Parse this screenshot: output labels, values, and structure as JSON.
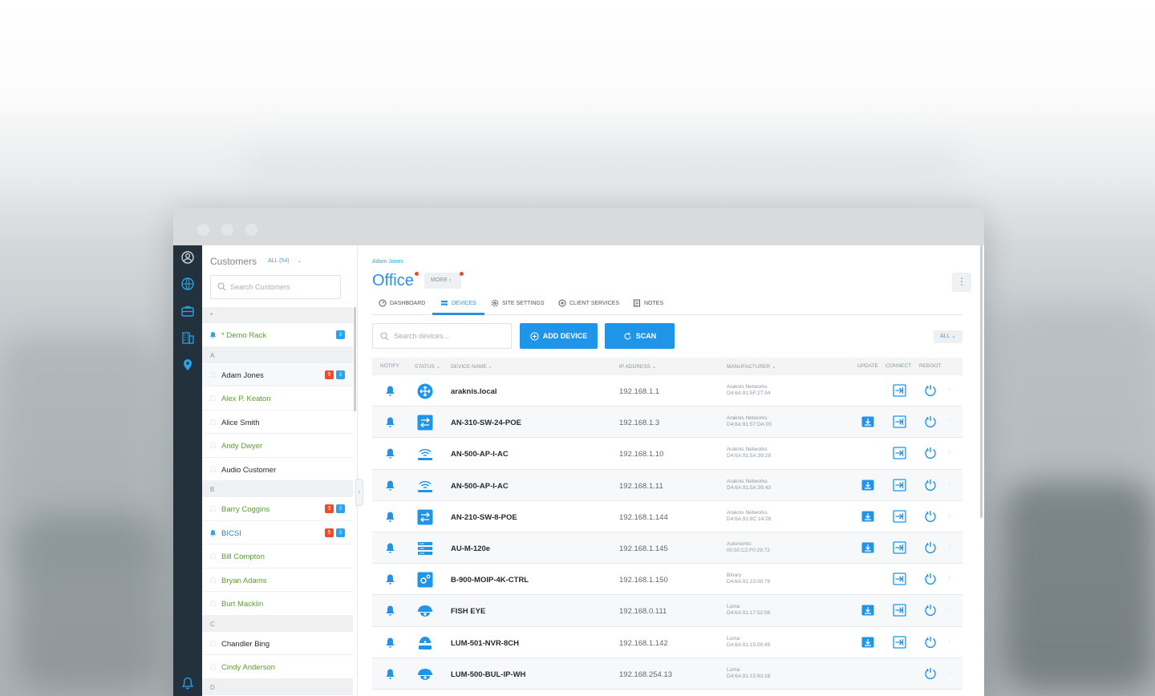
{
  "sidebar_rail": {
    "icons": [
      "user-circle-icon",
      "globe-icon",
      "briefcase-icon",
      "building-icon",
      "location-pin-icon"
    ],
    "bottom_icon": "bell-icon"
  },
  "customers": {
    "title": "Customers",
    "filter": "ALL (54)",
    "search_placeholder": "Search Customers",
    "sections": [
      {
        "letter": "*",
        "items": [
          {
            "name": "* Demo Rack",
            "style": "green",
            "notify": true,
            "badge_red": "",
            "badge_blue": true
          }
        ]
      },
      {
        "letter": "A",
        "items": [
          {
            "name": "Adam Jones",
            "style": "dark",
            "notify": false,
            "badge_red": "9",
            "badge_blue": true,
            "selected": true
          },
          {
            "name": "Alex P. Keaton",
            "style": "green",
            "notify": false,
            "badge_red": "",
            "badge_blue": false
          },
          {
            "name": "Alice Smith",
            "style": "dark",
            "notify": false,
            "badge_red": "",
            "badge_blue": false
          },
          {
            "name": "Andy Dwyer",
            "style": "green",
            "notify": false,
            "badge_red": "",
            "badge_blue": false
          },
          {
            "name": "Audio Customer",
            "style": "dark",
            "notify": false,
            "badge_red": "",
            "badge_blue": false
          }
        ]
      },
      {
        "letter": "B",
        "items": [
          {
            "name": "Barry Coggins",
            "style": "green",
            "notify": false,
            "badge_red": "3",
            "badge_blue": true
          },
          {
            "name": "BICSI",
            "style": "blue",
            "notify": true,
            "badge_red": "5",
            "badge_blue": true
          },
          {
            "name": "Bill Compton",
            "style": "green",
            "notify": false,
            "badge_red": "",
            "badge_blue": false
          },
          {
            "name": "Bryan Adams",
            "style": "green",
            "notify": false,
            "badge_red": "",
            "badge_blue": false
          },
          {
            "name": "Burt Macklin",
            "style": "green",
            "notify": false,
            "badge_red": "",
            "badge_blue": false
          }
        ]
      },
      {
        "letter": "C",
        "items": [
          {
            "name": "Chandler Bing",
            "style": "dark",
            "notify": false,
            "badge_red": "",
            "badge_blue": false
          },
          {
            "name": "Cindy Anderson",
            "style": "green",
            "notify": false,
            "badge_red": "",
            "badge_blue": false
          }
        ]
      },
      {
        "letter": "D",
        "items": []
      }
    ]
  },
  "site": {
    "breadcrumb": "Adam Jones",
    "title": "Office",
    "more_label": "MORE",
    "tabs": [
      {
        "label": "DASHBOARD",
        "icon": "dashboard-icon",
        "active": false
      },
      {
        "label": "DEVICES",
        "icon": "devices-icon",
        "active": true
      },
      {
        "label": "SITE SETTINGS",
        "icon": "settings-icon",
        "active": false
      },
      {
        "label": "CLIENT SERVICES",
        "icon": "services-icon",
        "active": false
      },
      {
        "label": "NOTES",
        "icon": "notes-icon",
        "active": false
      }
    ]
  },
  "toolbar": {
    "search_placeholder": "Search devices...",
    "add_device_label": "ADD DEVICE",
    "scan_label": "SCAN",
    "filter_label": "ALL"
  },
  "table": {
    "headers": {
      "notify": "NOTIFY",
      "status": "STATUS",
      "device_name": "DEVICE NAME",
      "ip_address": "IP ADDRESS",
      "manufacturer": "MANUFACTURER",
      "update": "UPDATE",
      "connect": "CONNECT",
      "reboot": "REBOOT"
    },
    "rows": [
      {
        "name": "araknis.local",
        "icon": "router",
        "ip": "192.168.1.1",
        "mfr": "Araknis Networks",
        "mac": "D4:6A:91:5F:27:54",
        "update": false,
        "connect": true
      },
      {
        "name": "AN-310-SW-24-POE",
        "icon": "switch",
        "ip": "192.168.1.3",
        "mfr": "Araknis Networks",
        "mac": "D4:6A:91:57:DA:00",
        "update": true,
        "connect": true
      },
      {
        "name": "AN-500-AP-I-AC",
        "icon": "wifi",
        "ip": "192.168.1.10",
        "mfr": "Araknis Networks",
        "mac": "D4:6A:91:5A:39:28",
        "update": false,
        "connect": true
      },
      {
        "name": "AN-500-AP-I-AC",
        "icon": "wifi",
        "ip": "192.168.1.11",
        "mfr": "Araknis Networks",
        "mac": "D4:6A:91:5A:39:43",
        "update": true,
        "connect": true
      },
      {
        "name": "AN-210-SW-8-POE",
        "icon": "switch",
        "ip": "192.168.1.144",
        "mfr": "Araknis Networks",
        "mac": "D4:6A:91:8C:14:28",
        "update": true,
        "connect": true
      },
      {
        "name": "AU-M-120e",
        "icon": "rack",
        "ip": "192.168.1.145",
        "mfr": "Autonomic",
        "mac": "00:50:C2:F0:29:72",
        "update": true,
        "connect": true
      },
      {
        "name": "B-900-MOIP-4K-CTRL",
        "icon": "controller",
        "ip": "192.168.1.150",
        "mfr": "Binary",
        "mac": "D4:6A:91:23:00:79",
        "update": false,
        "connect": true
      },
      {
        "name": "FISH EYE",
        "icon": "camera",
        "ip": "192.168.0.111",
        "mfr": "Luma",
        "mac": "D4:6A:91:17:52:08",
        "update": true,
        "connect": true
      },
      {
        "name": "LUM-501-NVR-8CH",
        "icon": "nvr",
        "ip": "192.168.1.142",
        "mfr": "Luma",
        "mac": "D4:6A:91:15:00:49",
        "update": true,
        "connect": true
      },
      {
        "name": "LUM-500-BUL-IP-WH",
        "icon": "camera",
        "ip": "192.168.254.13",
        "mfr": "Luma",
        "mac": "D4:6A:91:15:93:18",
        "update": false,
        "connect": false
      }
    ]
  },
  "colors": {
    "accent": "#2a8fe0",
    "primary_button": "#1f95ea",
    "badge_red": "#ee4a2b",
    "customer_green": "#5aa02c",
    "rail": "#23313d"
  }
}
